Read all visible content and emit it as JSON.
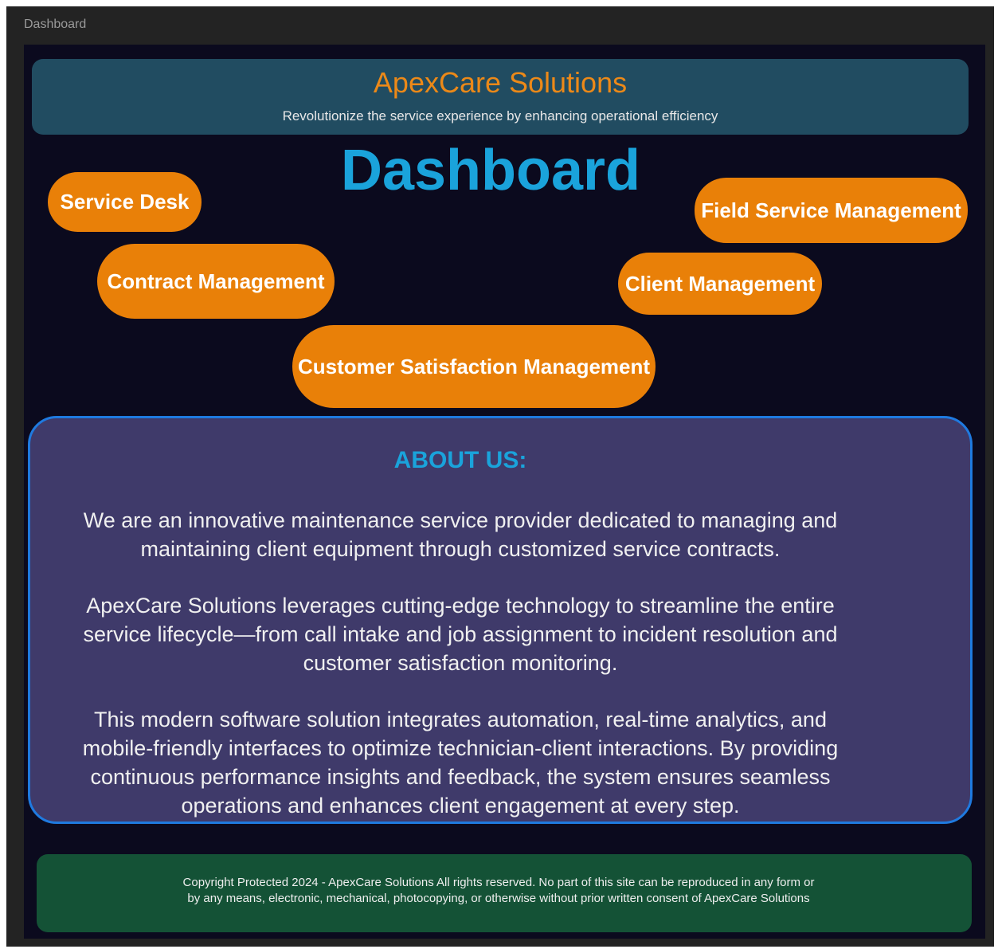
{
  "window": {
    "title": "Dashboard"
  },
  "header": {
    "brand": "ApexCare Solutions",
    "tagline": "Revolutionize the service experience by  enhancing operational efficiency"
  },
  "dashboard": {
    "title": "Dashboard",
    "nav": {
      "service_desk": "Service Desk",
      "contract_management": "Contract Management",
      "field_service_management": "Field Service Management",
      "client_management": "Client Management",
      "customer_satisfaction_management": "Customer Satisfaction Management"
    }
  },
  "about": {
    "heading": "ABOUT US:",
    "paragraphs": [
      "We are an innovative maintenance service provider dedicated  to managing and maintaining client equipment through customized service contracts.",
      "ApexCare Solutions leverages cutting-edge  technology to streamline the entire service lifecycle—from call intake and job assignment to  incident resolution and customer satisfaction monitoring.",
      "This modern software solution integrates automation, real-time analytics, and mobile-friendly  interfaces to optimize technician-client interactions. By providing continuous performance  insights and feedback, the system ensures seamless operations and enhances client  engagement at every step."
    ]
  },
  "footer": {
    "copyright": "Copyright Protected 2024 - ApexCare Solutions  All rights reserved. No part of this site can be reproduced in any form or by any means, electronic, mechanical, photocopying, or otherwise without prior written consent of ApexCare Solutions"
  },
  "colors": {
    "brand_orange": "#ec8918",
    "button_orange": "#e98008",
    "title_blue": "#1aa3db",
    "header_bg": "#214c61",
    "about_bg": "#3f3a6a",
    "about_border": "#1f7ae0",
    "footer_bg": "#145236",
    "canvas_bg": "#0b0a1e"
  }
}
